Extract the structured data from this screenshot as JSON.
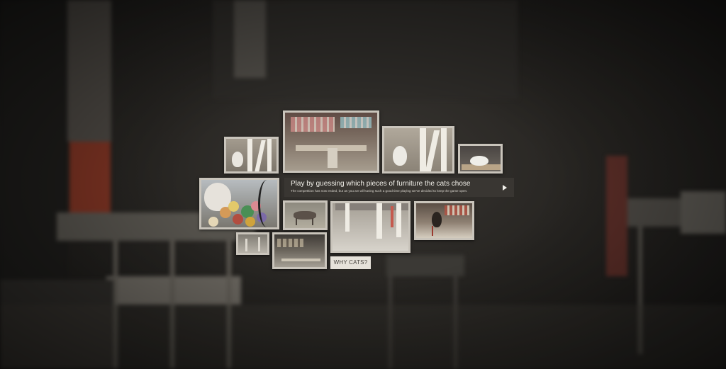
{
  "info": {
    "title": "Play by guessing which pieces of furniture the cats chose",
    "subtitle": "The competition has now ended, but as you are all having such a good time playing we've decided to keep the game open.",
    "play_icon": "play-icon"
  },
  "why_button": {
    "label": "WHY CATS?"
  },
  "colors": {
    "thumb_border": "#c9c4bb",
    "info_bg": "#3a3733",
    "button_bg": "#e6e2da"
  }
}
